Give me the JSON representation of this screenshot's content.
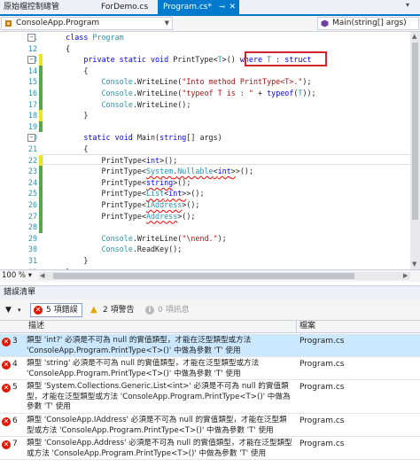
{
  "tabs": [
    {
      "label": "原始檔控制總管",
      "active": false
    },
    {
      "label": "ForDemo.cs",
      "active": false
    },
    {
      "label": "Program.cs*",
      "active": true,
      "icons": [
        "pin-icon",
        "close-icon"
      ]
    }
  ],
  "nav": {
    "project": "ConsoleApp.Program",
    "member": "Main(string[] args)"
  },
  "code_lines": [
    {
      "n": "11",
      "text": "    class Program"
    },
    {
      "n": "12",
      "text": "    {"
    },
    {
      "n": "13",
      "text": "        private static void PrintType<T>() where T : struct"
    },
    {
      "n": "14",
      "text": "        {"
    },
    {
      "n": "15",
      "text": "            Console.WriteLine(\"Into method PrintType<T>.\");"
    },
    {
      "n": "16",
      "text": "            Console.WriteLine(\"typeof T is : \" + typeof(T));"
    },
    {
      "n": "17",
      "text": "            Console.WriteLine();"
    },
    {
      "n": "18",
      "text": "        }"
    },
    {
      "n": "19",
      "text": ""
    },
    {
      "n": "20",
      "text": "        static void Main(string[] args)"
    },
    {
      "n": "21",
      "text": "        {"
    },
    {
      "n": "22",
      "text": "            PrintType<int>();"
    },
    {
      "n": "23",
      "text": "            PrintType<System.Nullable<int>>();"
    },
    {
      "n": "24",
      "text": "            PrintType<string>();"
    },
    {
      "n": "25",
      "text": "            PrintType<List<int>>();"
    },
    {
      "n": "26",
      "text": "            PrintType<IAddress>();"
    },
    {
      "n": "27",
      "text": "            PrintType<Address>();"
    },
    {
      "n": "28",
      "text": ""
    },
    {
      "n": "29",
      "text": "            Console.WriteLine(\"\\nend.\");"
    },
    {
      "n": "30",
      "text": "            Console.ReadKey();"
    },
    {
      "n": "31",
      "text": "        }"
    },
    {
      "n": "32",
      "text": "    }"
    }
  ],
  "zoom": "100 %",
  "error_list": {
    "title": "錯誤清單",
    "filter": {
      "errors": "5 項錯誤",
      "warnings": "2 項警告",
      "messages": "0 項訊息"
    },
    "columns": {
      "description": "描述",
      "file": "檔案"
    },
    "rows": [
      {
        "num": "3",
        "description": "類型 'int?' 必須是不可為 null 的實值類型，才能在泛型類型或方法 'ConsoleApp.Program.PrintType<T>()' 中做為參數 'T' 使用",
        "file": "Program.cs"
      },
      {
        "num": "4",
        "description": "類型 'string' 必須是不可為 null 的實值類型，才能在泛型類型或方法 'ConsoleApp.Program.PrintType<T>()' 中做為參數 'T' 使用",
        "file": "Program.cs"
      },
      {
        "num": "5",
        "description": "類型 'System.Collections.Generic.List<int>' 必須是不可為 null 的實值類型，才能在泛型類型或方法 'ConsoleApp.Program.PrintType<T>()' 中做為參數 'T' 使用",
        "file": "Program.cs"
      },
      {
        "num": "6",
        "description": "類型 'ConsoleApp.IAddress' 必須是不可為 null 的實值類型，才能在泛型類型或方法 'ConsoleApp.Program.PrintType<T>()' 中做為參數 'T' 使用",
        "file": "Program.cs"
      },
      {
        "num": "7",
        "description": "類型 'ConsoleApp.Address' 必須是不可為 null 的實值類型，才能在泛型類型或方法 'ConsoleApp.Program.PrintType<T>()' 中做為參數 'T' 使用",
        "file": "Program.cs"
      }
    ]
  },
  "colors": {
    "accent": "#007acc",
    "error": "#e51400",
    "warning": "#ffcc00",
    "highlight_box": "#d0252b",
    "selected_row": "#cce8ff"
  }
}
